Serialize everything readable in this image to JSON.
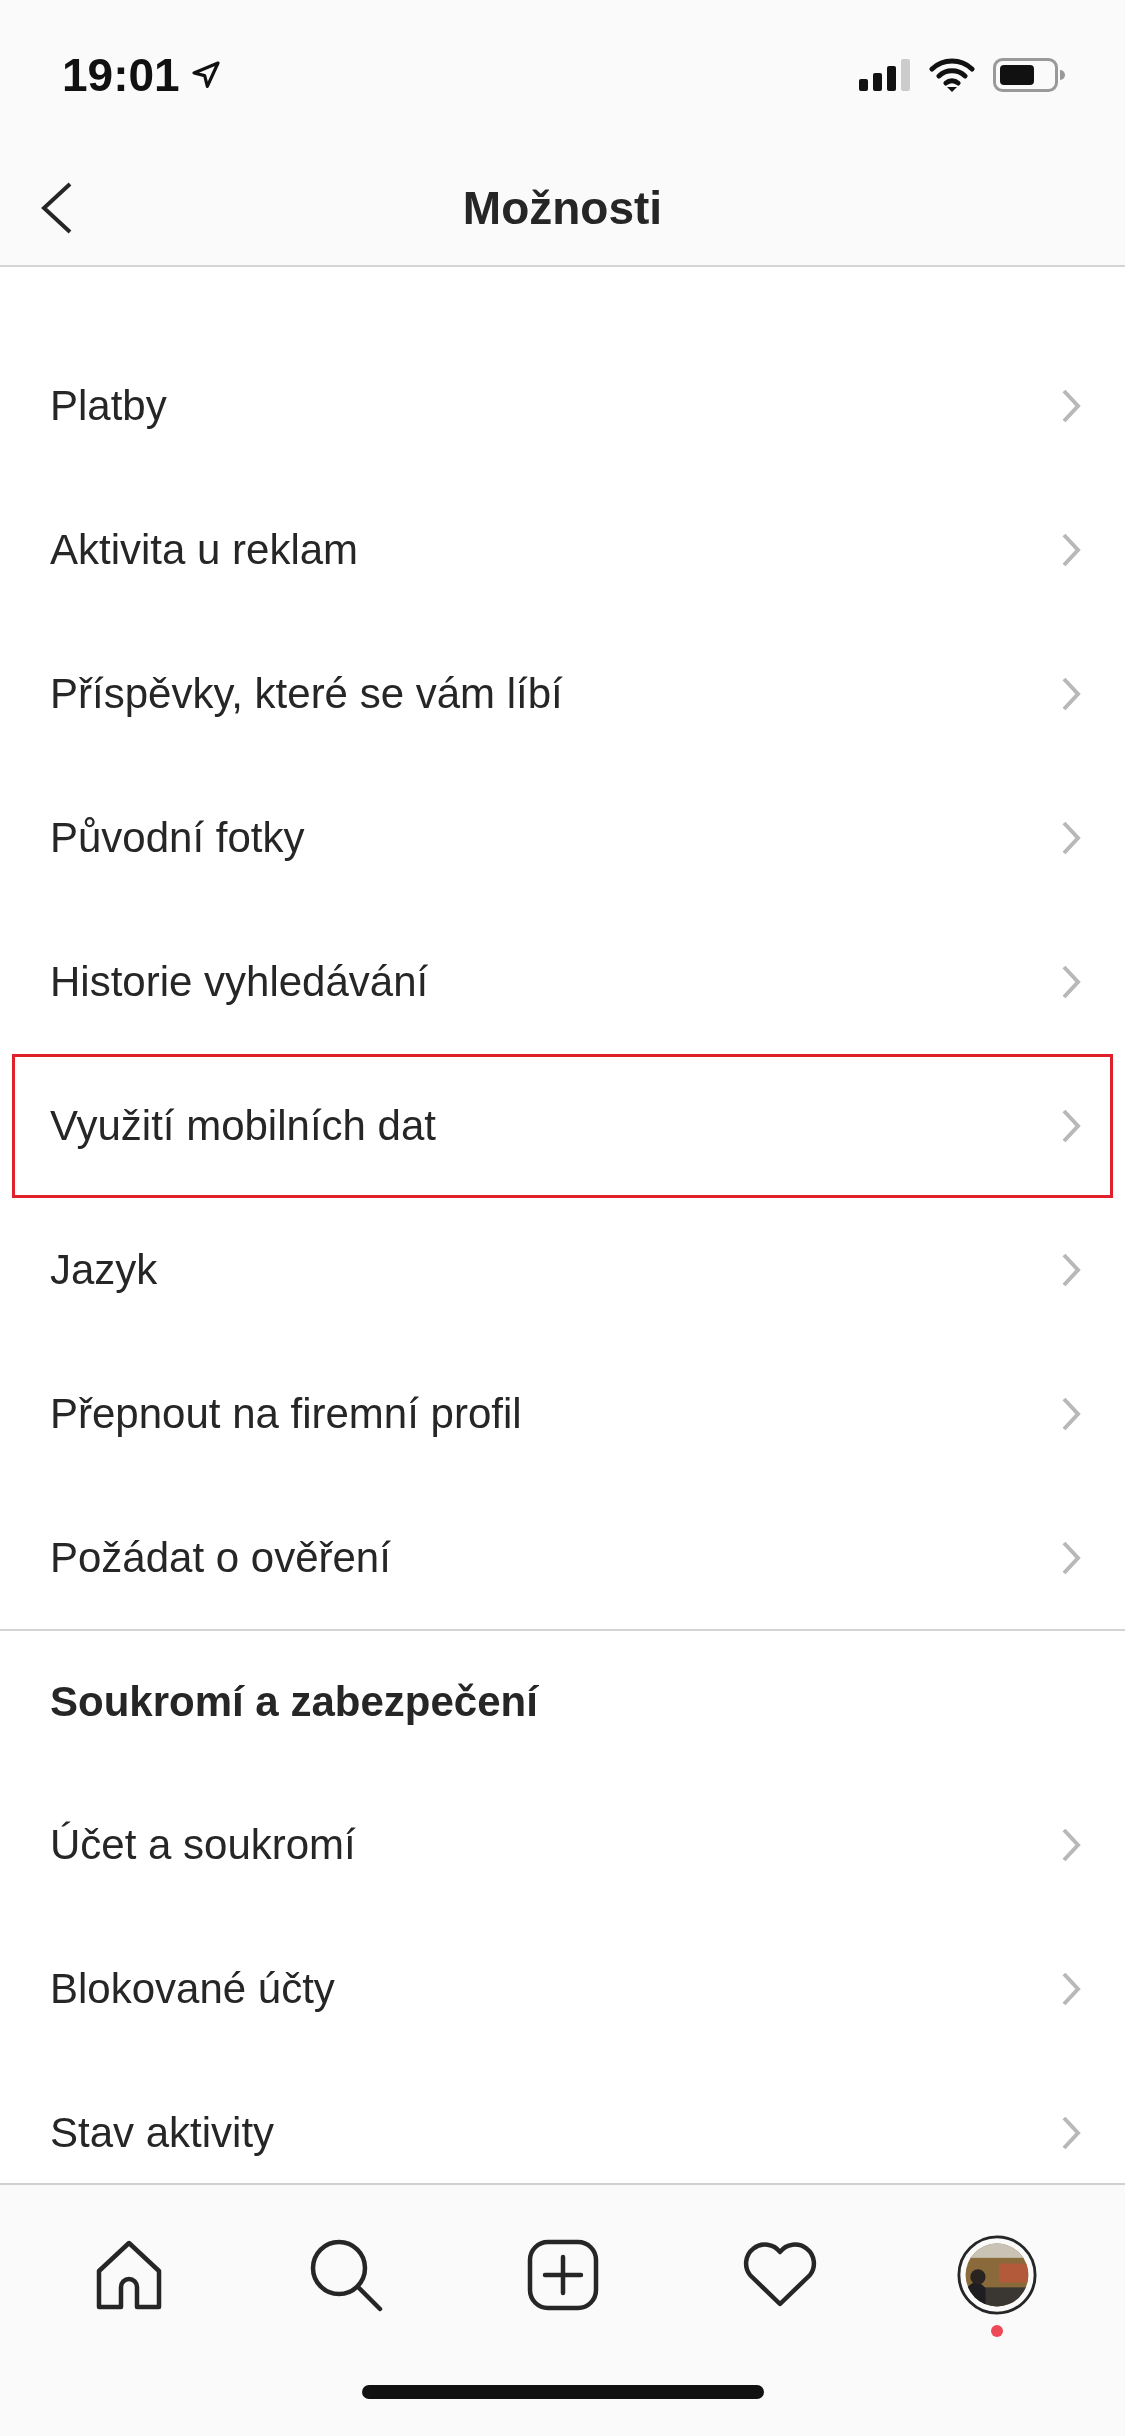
{
  "status_bar": {
    "time": "19:01"
  },
  "header": {
    "title": "Možnosti"
  },
  "rows": [
    {
      "kind": "item",
      "label": "Platby",
      "highlighted": false
    },
    {
      "kind": "item",
      "label": "Aktivita u reklam",
      "highlighted": false
    },
    {
      "kind": "item",
      "label": "Příspěvky, které se vám líbí",
      "highlighted": false
    },
    {
      "kind": "item",
      "label": "Původní fotky",
      "highlighted": false
    },
    {
      "kind": "item",
      "label": "Historie vyhledávání",
      "highlighted": false
    },
    {
      "kind": "item",
      "label": "Využití mobilních dat",
      "highlighted": true
    },
    {
      "kind": "item",
      "label": "Jazyk",
      "highlighted": false
    },
    {
      "kind": "item",
      "label": "Přepnout na firemní profil",
      "highlighted": false
    },
    {
      "kind": "item",
      "label": "Požádat o ověření",
      "highlighted": false
    },
    {
      "kind": "section",
      "label": "Soukromí a zabezpečení"
    },
    {
      "kind": "item",
      "label": "Účet a soukromí",
      "highlighted": false
    },
    {
      "kind": "item",
      "label": "Blokované účty",
      "highlighted": false
    },
    {
      "kind": "item",
      "label": "Stav aktivity",
      "highlighted": false
    }
  ],
  "tab_bar": {
    "profile_notification": true
  }
}
